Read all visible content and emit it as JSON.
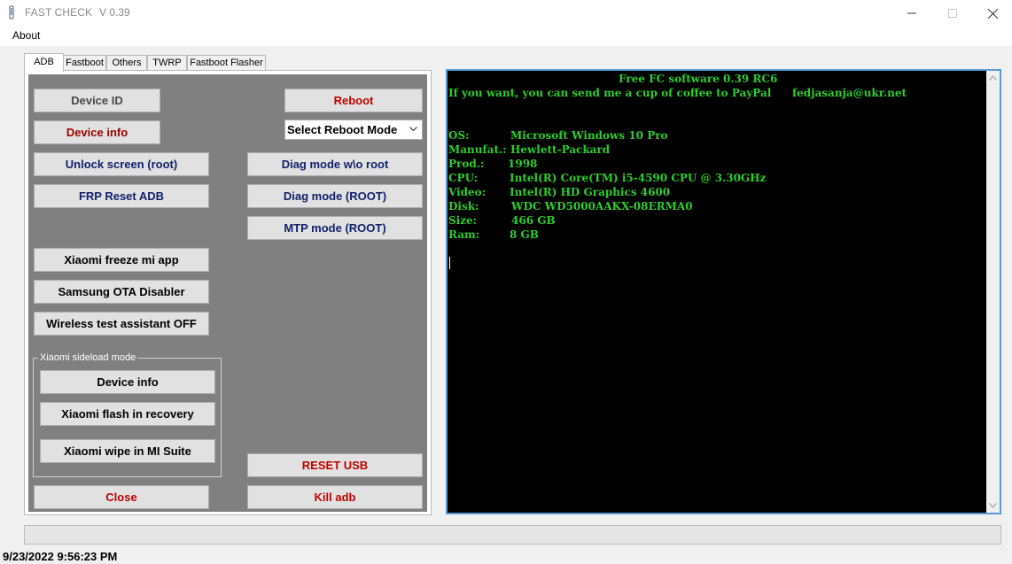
{
  "window": {
    "title": "FAST CHECK",
    "version": "V 0.39"
  },
  "menu": {
    "about": "About"
  },
  "tabs": [
    {
      "label": "ADB",
      "active": true
    },
    {
      "label": "Fastboot"
    },
    {
      "label": "Others"
    },
    {
      "label": "TWRP"
    },
    {
      "label": "Fastboot Flasher"
    }
  ],
  "adb": {
    "device_id": "Device ID",
    "device_info": "Device info",
    "unlock_screen": "Unlock screen (root)",
    "frp_reset": "FRP Reset ADB",
    "xiaomi_freeze": "Xiaomi freeze mi app",
    "samsung_ota": "Samsung OTA Disabler",
    "wireless_test": "Wireless test assistant OFF",
    "reboot": "Reboot",
    "reboot_mode": "Select Reboot Mode",
    "diag_no_root": "Diag mode w\\o root",
    "diag_root": "Diag mode (ROOT)",
    "mtp_root": "MTP mode (ROOT)",
    "sideload_group": "Xiaomi sideload mode",
    "sideload_device_info": "Device info",
    "xiaomi_flash_recovery": "Xiaomi flash in recovery",
    "xiaomi_wipe": "Xiaomi wipe in MI Suite",
    "reset_usb": "RESET USB",
    "close": "Close",
    "kill_adb": "Kill adb"
  },
  "console": {
    "header": "Free FC software 0.39 RC6",
    "coffee": "If you want, you can send me a cup of coffee to PayPal",
    "email": "fedjasanja@ukr.net",
    "info": [
      {
        "key": "OS:",
        "value": "Microsoft Windows 10 Pro"
      },
      {
        "key": "Manufat.:",
        "value": "Hewlett-Packard"
      },
      {
        "key": "Prod.:",
        "value": "1998"
      },
      {
        "key": "CPU:",
        "value": "Intel(R) Core(TM) i5-4590 CPU @ 3.30GHz"
      },
      {
        "key": "Video:",
        "value": "Intel(R) HD Graphics 4600"
      },
      {
        "key": "Disk:",
        "value": "WDC WD5000AAKX-08ERMA0"
      },
      {
        "key": "Size:",
        "value": "466 GB"
      },
      {
        "key": "Ram:",
        "value": "8 GB"
      }
    ]
  },
  "status": {
    "datetime": "9/23/2022 9:56:23 PM"
  },
  "colors": {
    "console_bg": "#000000",
    "console_text": "#2ecc2e",
    "panel_bg": "#808080",
    "accent": "#5b9bd5"
  }
}
